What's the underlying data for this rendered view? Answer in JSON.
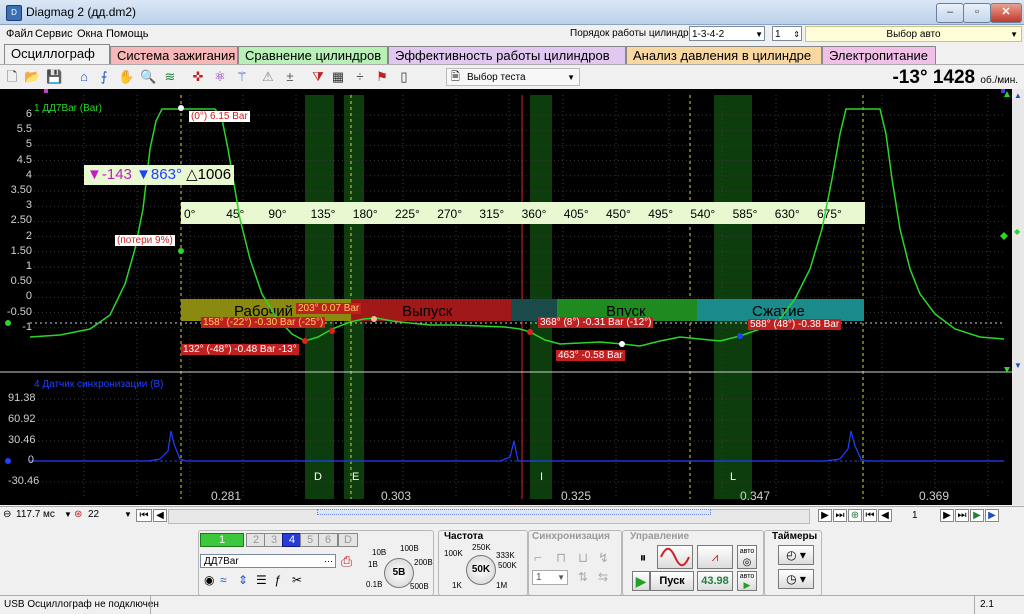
{
  "window": {
    "title": "Diagmag 2 (дд.dm2)",
    "minimize": "‒",
    "maximize": "▫",
    "close": "✕"
  },
  "menu": {
    "items": [
      "Файл",
      "Сервис",
      "Окна",
      "Помощь"
    ]
  },
  "header": {
    "cylinder_order_label": "Порядок работы цилиндров",
    "cylinder_order_value": "1-3-4-2",
    "cylinder_value": "1",
    "auto_select": "Выбор авто"
  },
  "tabs": [
    {
      "label": "Осциллограф",
      "color": "#f0f0f0"
    },
    {
      "label": "Система зажигания",
      "color": "#f8b8b8"
    },
    {
      "label": "Сравнение цилиндров",
      "color": "#b8f0b8"
    },
    {
      "label": "Эффективность работы цилиндров",
      "color": "#e0c8f0"
    },
    {
      "label": "Анализ давления в цилиндре",
      "color": "#f8d8a0"
    },
    {
      "label": "Электропитание",
      "color": "#f0c0e8"
    }
  ],
  "toolbar": {
    "test_select": "Выбор теста",
    "rpm_angle": "-13°",
    "rpm_value": "1428",
    "rpm_unit": "об./мин.",
    "icons": [
      "new-icon",
      "open-icon",
      "save-icon",
      "cursor-icon",
      "measure-icon",
      "hand-icon",
      "zoom-icon",
      "fft-icon",
      "sync-icon",
      "scale-icon",
      "trigger-icon",
      "marker-icon",
      "grid-icon",
      "split-icon",
      "flag-icon",
      "page-icon"
    ]
  },
  "scope": {
    "channel1_label": "1 ДД7Bar (Bar)",
    "channel2_label": "4 Датчик синхронизации (В)",
    "y1_ticks": [
      "6",
      "5.5",
      "5",
      "4.5",
      "4",
      "3.50",
      "3",
      "2.50",
      "2",
      "1.50",
      "1",
      "0.50",
      "0",
      "-0.50",
      "-1"
    ],
    "y2_ticks": [
      "91.38",
      "60.92",
      "30.46",
      "0",
      "-30.46"
    ],
    "x_ticks": [
      "0.281",
      "0.303",
      "0.325",
      "0.347",
      "0.369"
    ],
    "angle_ticks": [
      "0°",
      "45°",
      "90°",
      "135°",
      "180°",
      "225°",
      "270°",
      "315°",
      "360°",
      "405°",
      "450°",
      "495°",
      "540°",
      "585°",
      "630°",
      "675°"
    ],
    "marker_readout": {
      "a": "-143",
      "b": "863°",
      "delta": "1006"
    },
    "phases": [
      {
        "label": "Рабочий",
        "color": "#8a8a10"
      },
      {
        "label": "Выпуск",
        "color": "#a01818"
      },
      {
        "label": "Впуск",
        "color": "#1f8a1f"
      },
      {
        "label": "Сжатие",
        "color": "#1a8a8a"
      }
    ],
    "annotations": [
      "(0°) 6.15 Bar",
      "(потери 9%)",
      "158° (-22°) -0.30 Bar (-25°)",
      "203° 0.07 Bar",
      "132° (-48°) -0.48 Bar -13°",
      "368° (8°) -0.31 Bar (-12°)",
      "463° -0.58 Bar",
      "588° (48°) -0.38 Bar"
    ],
    "zone_letters": [
      "D",
      "E",
      "I",
      "L"
    ]
  },
  "nav": {
    "timebase": "117.7 мс",
    "channel": "22",
    "page": "1"
  },
  "panel": {
    "channels": [
      "1",
      "2",
      "3",
      "4",
      "5",
      "6",
      "D"
    ],
    "sensor": "ДД7Bar",
    "voltage_dial": {
      "center": "5В",
      "labels": [
        "10В",
        "100В",
        "1В",
        "200В",
        "0.1В",
        "500В"
      ]
    },
    "freq_title": "Частота",
    "freq_dial": {
      "center": "50K",
      "labels": [
        "250K",
        "100K",
        "333K",
        "500K",
        "1K",
        "1M"
      ]
    },
    "sync_title": "Синхронизация",
    "sync_value": "1",
    "control_title": "Управление",
    "start_label": "Пуск",
    "counter": "43.98",
    "auto_label": "авто",
    "timers_title": "Таймеры"
  },
  "status": {
    "text": "USB Осциллограф не подключен",
    "version": "2.1"
  },
  "colors": {
    "trace": "#29d629",
    "sync_trace": "#2040ff",
    "grid": "#4a4a4a",
    "cursor": "#e02020"
  }
}
